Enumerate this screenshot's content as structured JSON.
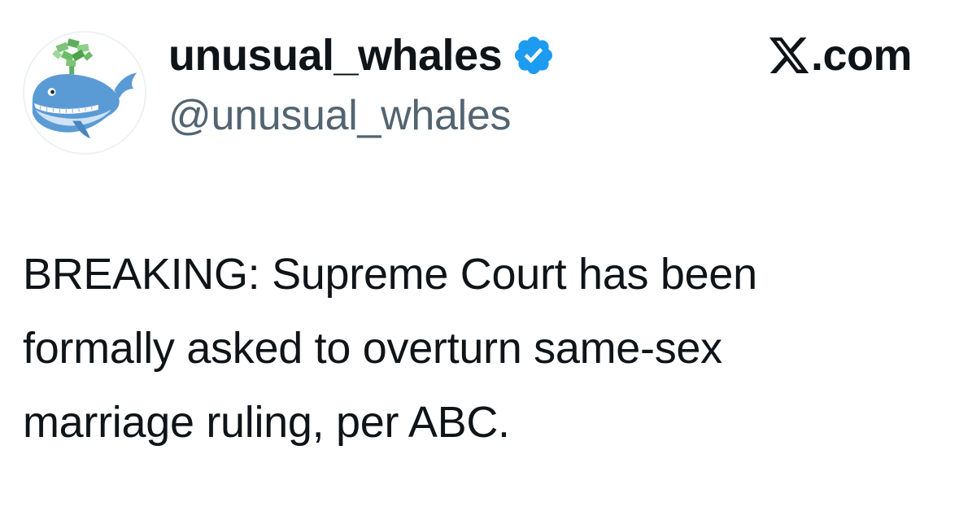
{
  "author": {
    "display_name": "unusual_whales",
    "handle": "@unusual_whales",
    "verified": true,
    "verified_badge_color": "#1d9bf0",
    "avatar_icon": "whale-with-money-icon"
  },
  "brand": {
    "logo_icon": "x-logo-icon",
    "label": ".com"
  },
  "tweet": {
    "lines": [
      "BREAKING: Supreme Court has been",
      "formally asked to overturn same-sex",
      "marriage ruling, per ABC."
    ]
  },
  "colors": {
    "text_primary": "#0f1419",
    "text_secondary": "#536471",
    "whale_blue": "#5b9bd5"
  }
}
